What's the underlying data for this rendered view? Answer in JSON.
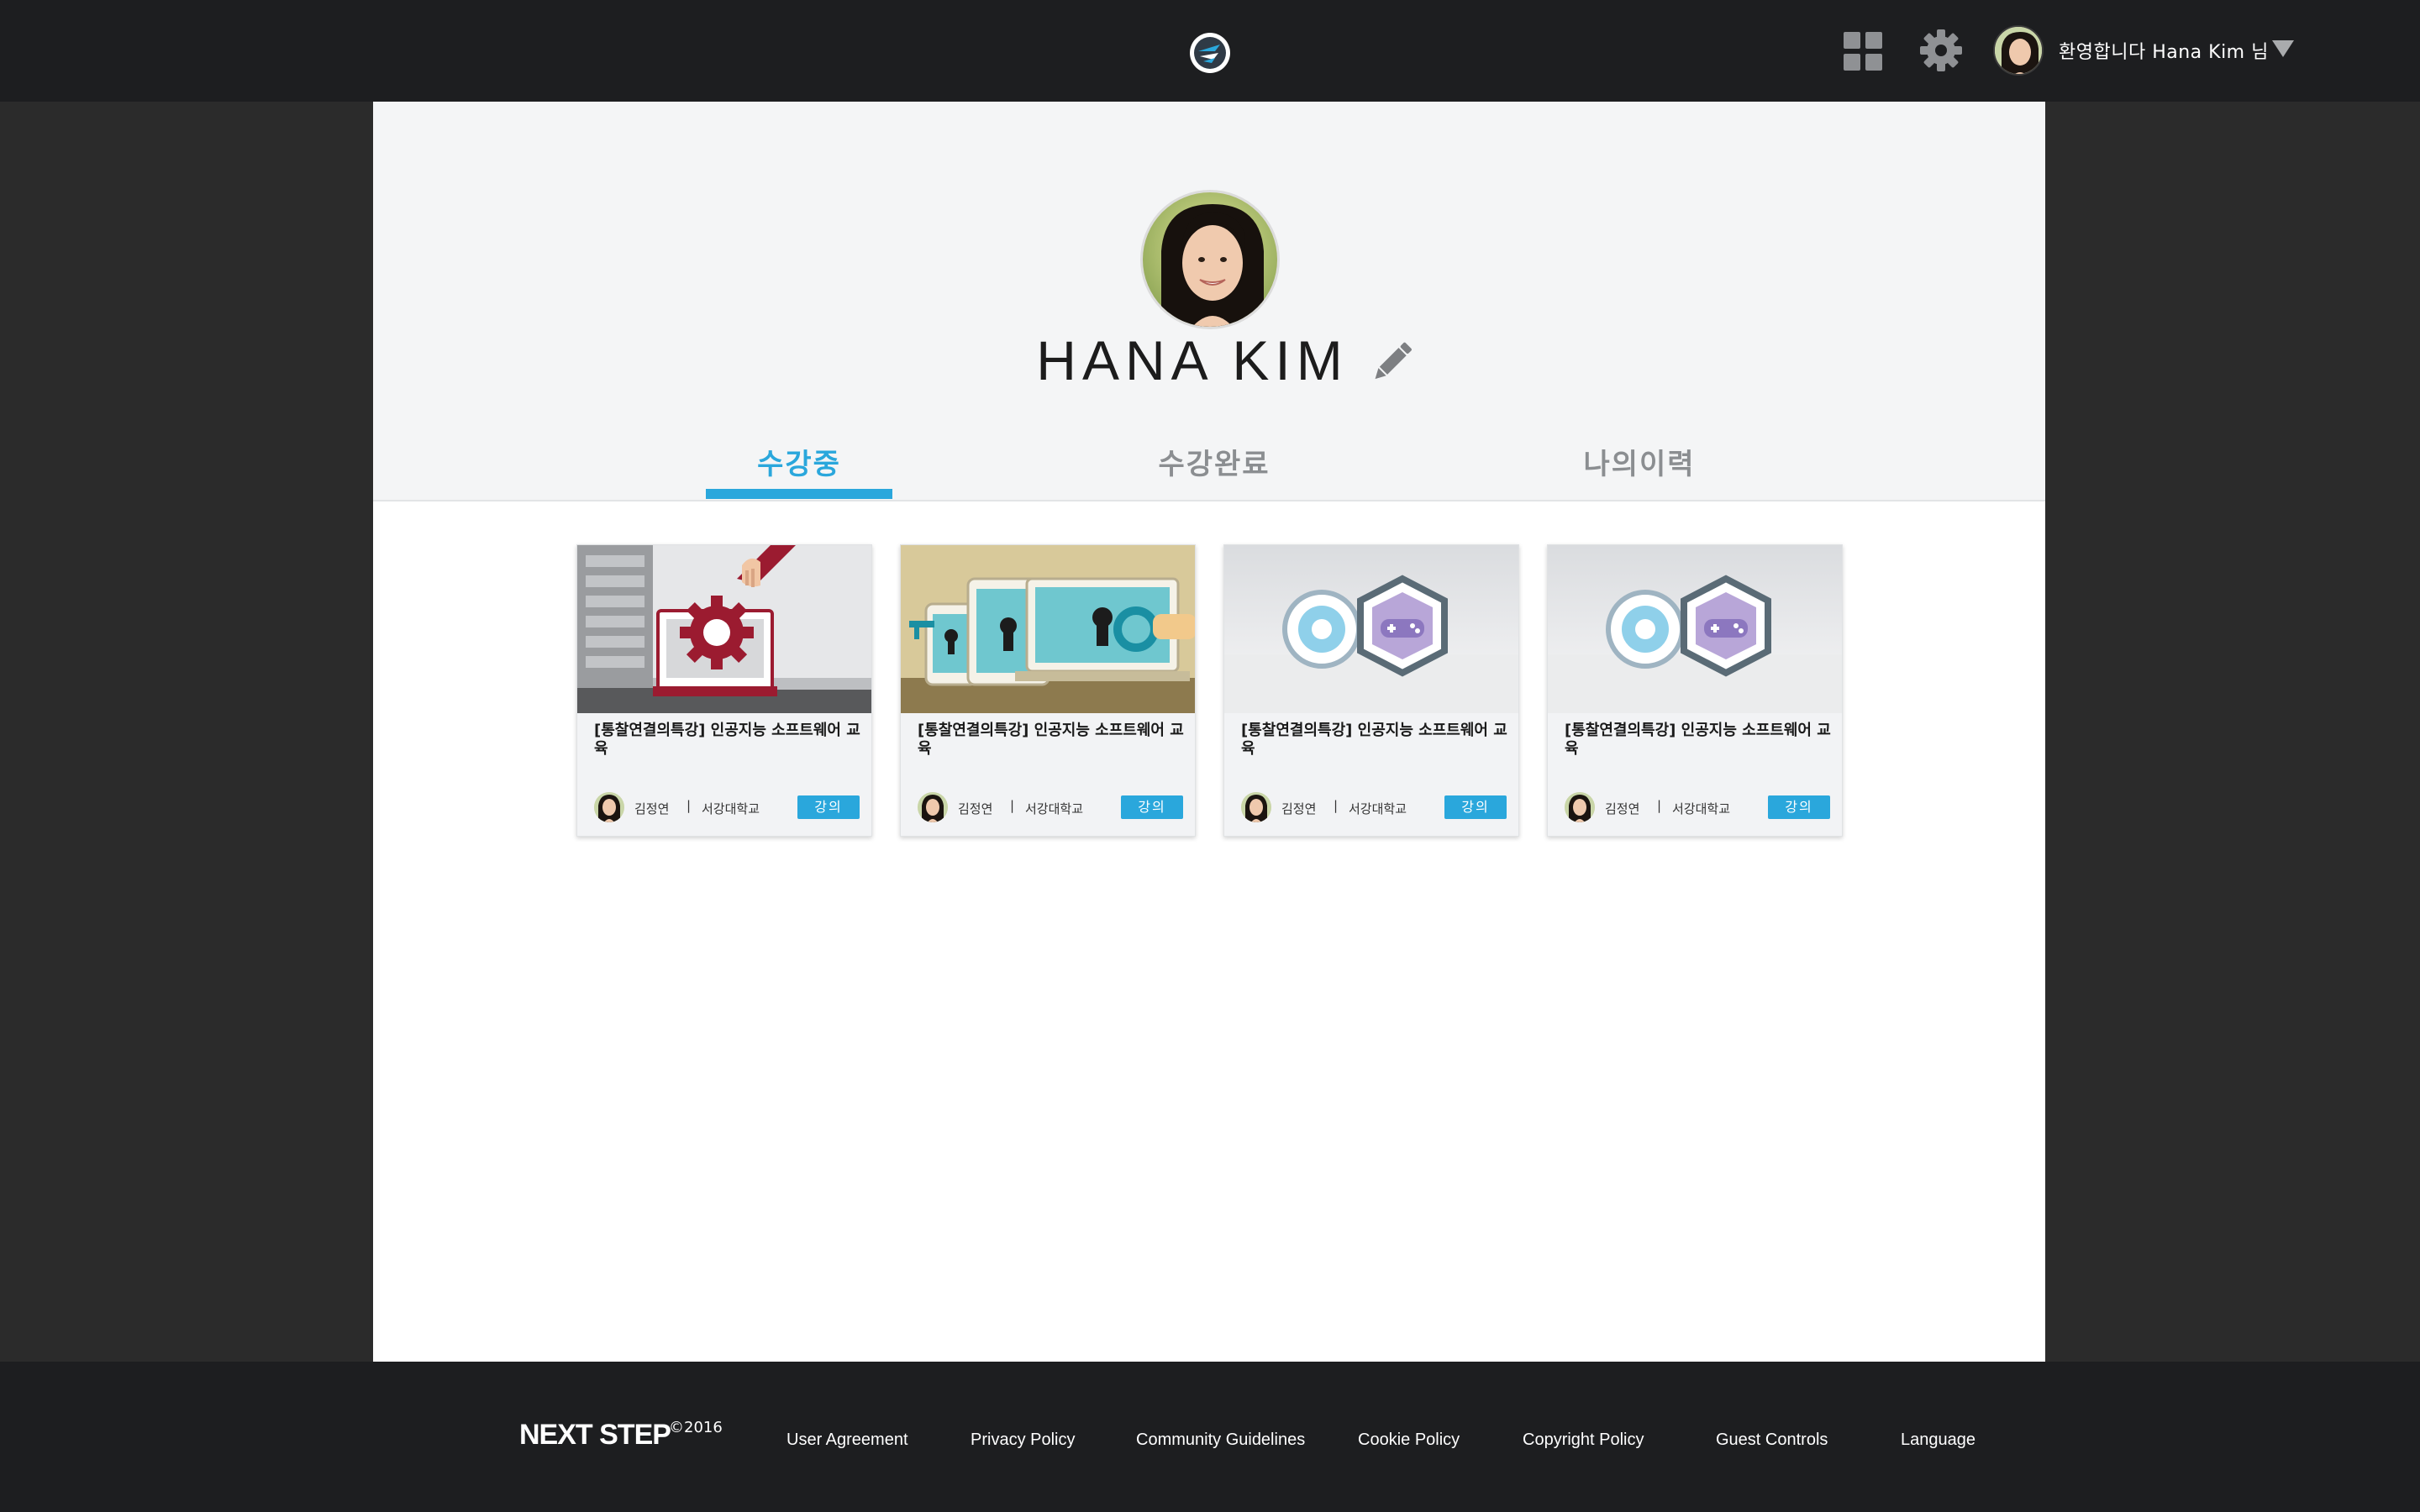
{
  "header": {
    "welcome_text": "환영합니다 Hana Kim 님",
    "icons": {
      "logo": "site-logo-icon",
      "apps": "grid-apps-icon",
      "settings": "gear-icon",
      "dropdown": "caret-down-icon"
    }
  },
  "profile": {
    "name": "HANA KIM",
    "edit_icon": "pencil-icon"
  },
  "tabs": [
    {
      "label": "수강중",
      "active": true
    },
    {
      "label": "수강완료",
      "active": false
    },
    {
      "label": "나의이력",
      "active": false
    }
  ],
  "courses": [
    {
      "title": "[통찰연결의특강] 인공지능 소프트웨어 교육",
      "instructor": "김정연",
      "separator": "|",
      "school": "서강대학교",
      "badge": "강의",
      "thumbnail": "gear-laptop-illustration"
    },
    {
      "title": "[통찰연결의특강] 인공지능 소프트웨어 교육",
      "instructor": "김정연",
      "separator": "|",
      "school": "서강대학교",
      "badge": "강의",
      "thumbnail": "devices-keyholes-illustration"
    },
    {
      "title": "[통찰연결의특강] 인공지능 소프트웨어 교육",
      "instructor": "김정연",
      "separator": "|",
      "school": "서강대학교",
      "badge": "강의",
      "thumbnail": "gear-gamepad-hexagon-illustration"
    },
    {
      "title": "[통찰연결의특강] 인공지능 소프트웨어 교육",
      "instructor": "김정연",
      "separator": "|",
      "school": "서강대학교",
      "badge": "강의",
      "thumbnail": "gear-gamepad-hexagon-illustration"
    }
  ],
  "footer": {
    "brand": "NEXT STEP",
    "copyright": "©2016",
    "links": [
      "User Agreement",
      "Privacy Policy",
      "Community Guidelines",
      "Cookie Policy",
      "Copyright Policy",
      "Guest Controls",
      "Language"
    ]
  },
  "colors": {
    "accent": "#2aa7dc",
    "topbar": "#1d1e20",
    "page_bg": "#2b2b2b",
    "profile_bg": "#f4f5f6"
  }
}
